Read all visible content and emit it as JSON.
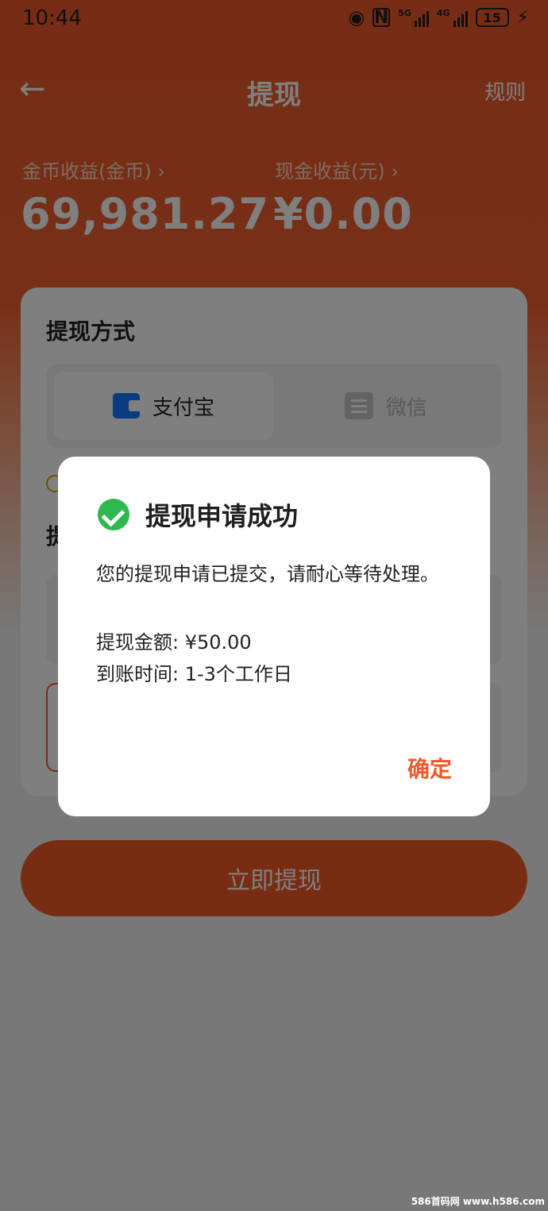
{
  "status_bar": {
    "time": "10:44",
    "sig1": "5G",
    "sig2": "4G",
    "battery": "15"
  },
  "header": {
    "title": "提现",
    "rules": "规则",
    "back": "←"
  },
  "stats": [
    {
      "label": "金币收益(金币) ›",
      "value": "69,981.27"
    },
    {
      "label": "现金收益(元) ›",
      "value": "¥0.00"
    }
  ],
  "card": {
    "title": "提现方式",
    "sub_title": "提",
    "methods": [
      {
        "label": "支付宝"
      },
      {
        "label": "微信"
      }
    ]
  },
  "cta": {
    "label": "立即提现"
  },
  "dialog": {
    "title": "提现申请成功",
    "message": "您的提现申请已提交，请耐心等待处理。",
    "amount": "提现金额: ¥50.00",
    "arrival": "到账时间: 1-3个工作日",
    "confirm": "确定"
  },
  "watermark": "586首码网 www.h586.com",
  "colors": {
    "brand": "#ee5a2a",
    "success": "#2eb84e",
    "alipay": "#1677ff"
  }
}
